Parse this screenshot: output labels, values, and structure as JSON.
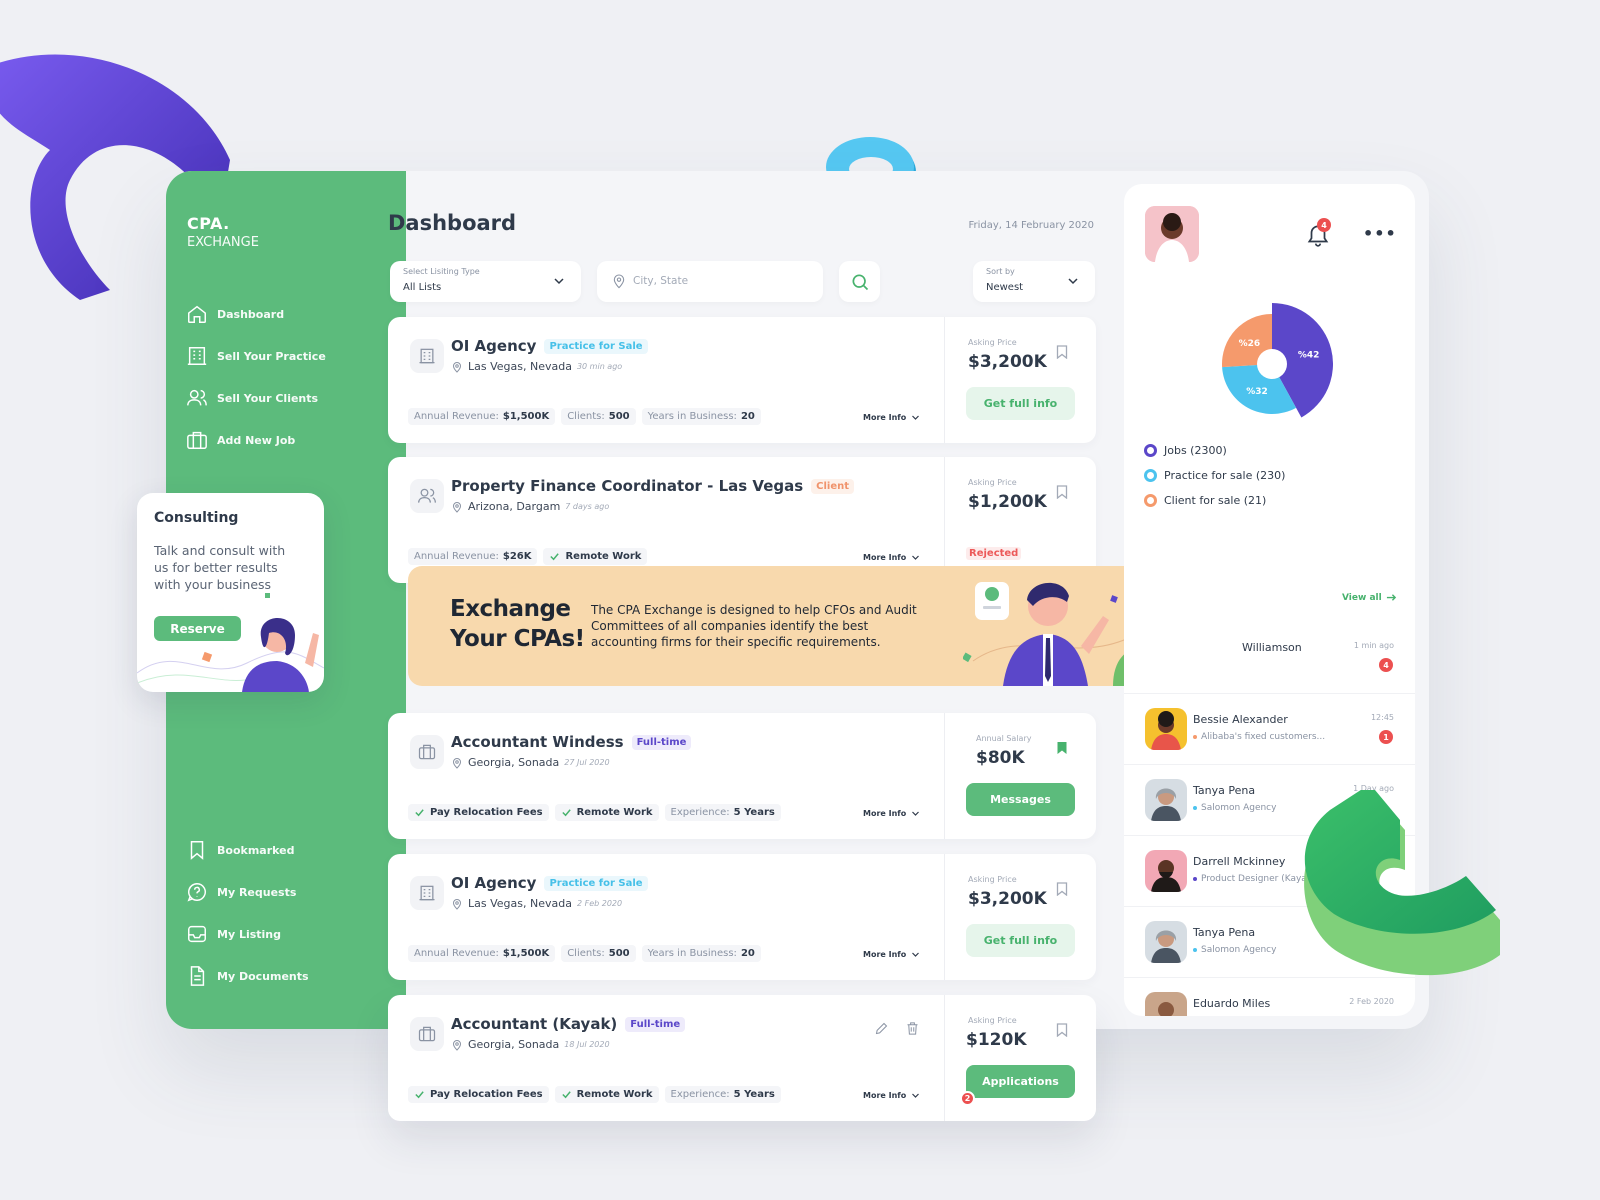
{
  "brand": {
    "line1": "CPA.",
    "line2": "EXCHANGE"
  },
  "sidebar": {
    "top": [
      {
        "label": "Dashboard",
        "icon": "home-icon"
      },
      {
        "label": "Sell Your Practice",
        "icon": "building-icon"
      },
      {
        "label": "Sell Your Clients",
        "icon": "users-icon"
      },
      {
        "label": "Add New Job",
        "icon": "briefcase-icon"
      }
    ],
    "bottom": [
      {
        "label": "Bookmarked",
        "icon": "bookmark-icon"
      },
      {
        "label": "My Requests",
        "icon": "question-icon"
      },
      {
        "label": "My Listing",
        "icon": "inbox-icon"
      },
      {
        "label": "My Documents",
        "icon": "document-icon"
      }
    ]
  },
  "consulting": {
    "title": "Consulting",
    "text": "Talk and consult with us for better results with your business",
    "button": "Reserve"
  },
  "main": {
    "title": "Dashboard",
    "date": "Friday, 14 February 2020",
    "filters": {
      "listing_label": "Select Lisiting Type",
      "listing_value": "All Lists",
      "city_placeholder": "City, State",
      "sort_label": "Sort by",
      "sort_value": "Newest"
    }
  },
  "listings": [
    {
      "title": "OI Agency",
      "tag": "Practice for Sale",
      "location": "Las Vegas, Nevada",
      "ago": "30 min ago",
      "chips": [
        {
          "k": "Annual Revenue:",
          "v": "$1,500K"
        },
        {
          "k": "Clients:",
          "v": "500"
        },
        {
          "k": "Years in Business:",
          "v": "20"
        }
      ],
      "more": "More Info",
      "price_label": "Asking Price",
      "price": "$3,200K",
      "action": "Get full info"
    },
    {
      "title": "Property Finance Coordinator - Las Vegas",
      "tag": "Client",
      "location": "Arizona, Dargam",
      "ago": "7 days ago",
      "chips": [
        {
          "k": "Annual Revenue:",
          "v": "$26K"
        }
      ],
      "check_chips": [
        "Remote Work"
      ],
      "more": "More Info",
      "price_label": "Asking Price",
      "price": "$1,200K",
      "status": "Rejected"
    },
    {
      "title": "Accountant Windess",
      "tag": "Full-time",
      "location": "Georgia, Sonada",
      "ago": "27 Jul 2020",
      "check_chips": [
        "Pay Relocation Fees",
        "Remote Work"
      ],
      "chips": [
        {
          "k": "Experience:",
          "v": "5 Years"
        }
      ],
      "more": "More Info",
      "price_label": "Annual Salary",
      "price": "$80K",
      "action": "Messages"
    },
    {
      "title": "OI Agency",
      "tag": "Practice for Sale",
      "location": "Las Vegas, Nevada",
      "ago": "2 Feb 2020",
      "chips": [
        {
          "k": "Annual Revenue:",
          "v": "$1,500K"
        },
        {
          "k": "Clients:",
          "v": "500"
        },
        {
          "k": "Years in Business:",
          "v": "20"
        }
      ],
      "more": "More Info",
      "price_label": "Asking Price",
      "price": "$3,200K",
      "action": "Get full info"
    },
    {
      "title": "Accountant (Kayak)",
      "tag": "Full-time",
      "location": "Georgia, Sonada",
      "ago": "18 Jul 2020",
      "check_chips": [
        "Pay Relocation Fees",
        "Remote Work"
      ],
      "chips": [
        {
          "k": "Experience:",
          "v": "5 Years"
        }
      ],
      "more": "More Info",
      "price_label": "Asking Price",
      "price": "$120K",
      "action": "Applications",
      "badge": "2"
    }
  ],
  "banner": {
    "headline_1": "Exchange",
    "headline_2": "Your CPAs!",
    "text": "The CPA Exchange is designed to help CFOs and Audit Committees of all companies identify the best accounting firms for their specific requirements."
  },
  "right_panel": {
    "notifications_count": "4",
    "chart_data": {
      "type": "pie",
      "slices": [
        {
          "label": "Jobs",
          "percent": 42,
          "text": "%42",
          "color": "#5b47c9"
        },
        {
          "label": "Practice for sale",
          "percent": 32,
          "text": "%32",
          "color": "#4cc3ee"
        },
        {
          "label": "Client for sale",
          "percent": 26,
          "text": "%26",
          "color": "#f59a6c"
        }
      ],
      "legend": [
        "Jobs (2300)",
        "Practice for sale (230)",
        "Client for sale (21)"
      ]
    },
    "view_all": "View all",
    "messages": [
      {
        "name": "Williamson",
        "time": "1 min ago",
        "sub": "",
        "count": "4",
        "dot": "#5b47c9"
      },
      {
        "name": "Bessie Alexander",
        "time": "12:45",
        "sub": "Alibaba's fixed customers...",
        "count": "1",
        "dot": "#f59a6c"
      },
      {
        "name": "Tanya Pena",
        "time": "1 Day ago",
        "sub": "Salomon Agency",
        "dot": "#4cc3ee"
      },
      {
        "name": "Darrell Mckinney",
        "time": "",
        "sub": "Product Designer (Kayak)",
        "dot": "#5b47c9"
      },
      {
        "name": "Tanya Pena",
        "time": "",
        "sub": "Salomon Agency",
        "dot": "#4cc3ee"
      },
      {
        "name": "Eduardo Miles",
        "time": "2 Feb 2020",
        "sub": ""
      }
    ]
  }
}
